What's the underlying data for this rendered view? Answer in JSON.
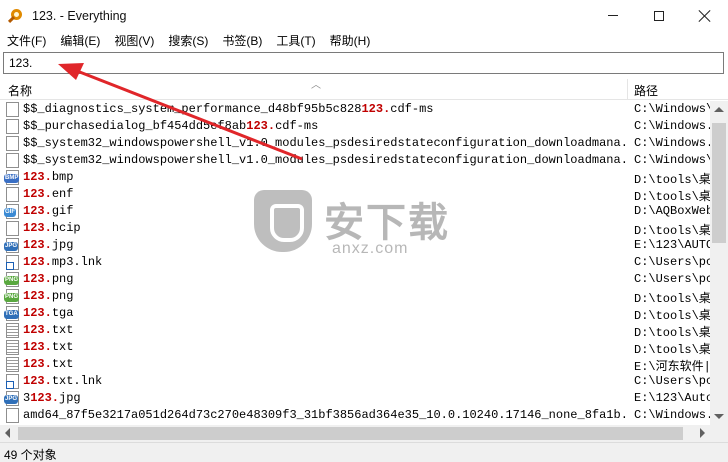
{
  "window": {
    "title": "123. - Everything"
  },
  "menu": [
    "文件(F)",
    "编辑(E)",
    "视图(V)",
    "搜索(S)",
    "书签(B)",
    "工具(T)",
    "帮助(H)"
  ],
  "search": {
    "value": "123."
  },
  "columns": {
    "name": "名称",
    "path": "路径"
  },
  "rows": [
    {
      "icon": "generic-file-icon",
      "pre": "$$_diagnostics_system_performance_d48bf95b5c828",
      "hl": "123.",
      "post": "cdf-ms",
      "path": "C:\\Windows\\"
    },
    {
      "icon": "generic-file-icon",
      "pre": "$$_purchasedialog_bf454dd5ef8ab",
      "hl": "123.",
      "post": "cdf-ms",
      "path": "C:\\Windows."
    },
    {
      "icon": "generic-file-icon",
      "pre": "$$_system32_windowspowershell_v1.0_modules_psdesiredstateconfiguration_downloadmana...",
      "hl": "",
      "post": "",
      "path": "C:\\Windows."
    },
    {
      "icon": "generic-file-icon",
      "pre": "$$_system32_windowspowershell_v1.0_modules_psdesiredstateconfiguration_downloadmana...",
      "hl": "",
      "post": "",
      "path": "C:\\Windows\\"
    },
    {
      "icon": "bmp-file-icon",
      "tag": "BMP",
      "color": "#3a6fc4",
      "pre": "",
      "hl": "123.",
      "post": "bmp",
      "path": "D:\\tools\\桌"
    },
    {
      "icon": "generic-file-icon",
      "pre": "",
      "hl": "123.",
      "post": "enf",
      "path": "D:\\tools\\桌"
    },
    {
      "icon": "gif-file-icon",
      "tag": "GIF",
      "color": "#3a8ad4",
      "pre": "",
      "hl": "123.",
      "post": "gif",
      "path": "D:\\AQBoxWeb"
    },
    {
      "icon": "generic-file-icon",
      "pre": "",
      "hl": "123.",
      "post": "hcip",
      "path": "D:\\tools\\桌"
    },
    {
      "icon": "jpg-file-icon",
      "tag": "JPG",
      "color": "#2f6fb8",
      "pre": "",
      "hl": "123.",
      "post": "jpg",
      "path": "E:\\123\\AUTO"
    },
    {
      "icon": "shortcut-file-icon",
      "shortcut": true,
      "pre": "",
      "hl": "123.",
      "post": "mp3.lnk",
      "path": "C:\\Users\\pc"
    },
    {
      "icon": "png-file-icon",
      "tag": "PNG",
      "color": "#59a83f",
      "pre": "",
      "hl": "123.",
      "post": "png",
      "path": "C:\\Users\\pc"
    },
    {
      "icon": "png-file-icon",
      "tag": "PNG",
      "color": "#59a83f",
      "pre": "",
      "hl": "123.",
      "post": "png",
      "path": "D:\\tools\\桌"
    },
    {
      "icon": "tga-file-icon",
      "tag": "TGA",
      "color": "#2f6fb8",
      "pre": "",
      "hl": "123.",
      "post": "tga",
      "path": "D:\\tools\\桌"
    },
    {
      "icon": "text-file-icon",
      "pre": "",
      "hl": "123.",
      "post": "txt",
      "path": "D:\\tools\\桌"
    },
    {
      "icon": "text-file-icon",
      "pre": "",
      "hl": "123.",
      "post": "txt",
      "path": "D:\\tools\\桌"
    },
    {
      "icon": "text-file-icon",
      "pre": "",
      "hl": "123.",
      "post": "txt",
      "path": "E:\\河东软件|"
    },
    {
      "icon": "shortcut-file-icon",
      "shortcut": true,
      "pre": "",
      "hl": "123.",
      "post": "txt.lnk",
      "path": "C:\\Users\\pc"
    },
    {
      "icon": "jpg-file-icon",
      "tag": "JPG",
      "color": "#2f6fb8",
      "pre": "3",
      "hl": "123.",
      "post": "jpg",
      "path": "E:\\123\\Auto"
    },
    {
      "icon": "generic-file-icon",
      "pre": "amd64_87f5e3217a051d264d73c270e48309f3_31bf3856ad364e35_10.0.10240.17146_none_8fa1b...",
      "hl": "",
      "post": "",
      "path": "C:\\Windows."
    }
  ],
  "status": {
    "text": "49 个对象"
  },
  "watermark": {
    "cn": "安下载",
    "en": "anxz.com"
  },
  "colors": {
    "highlight": "#c00000",
    "annotation_arrow": "#e0262a"
  }
}
